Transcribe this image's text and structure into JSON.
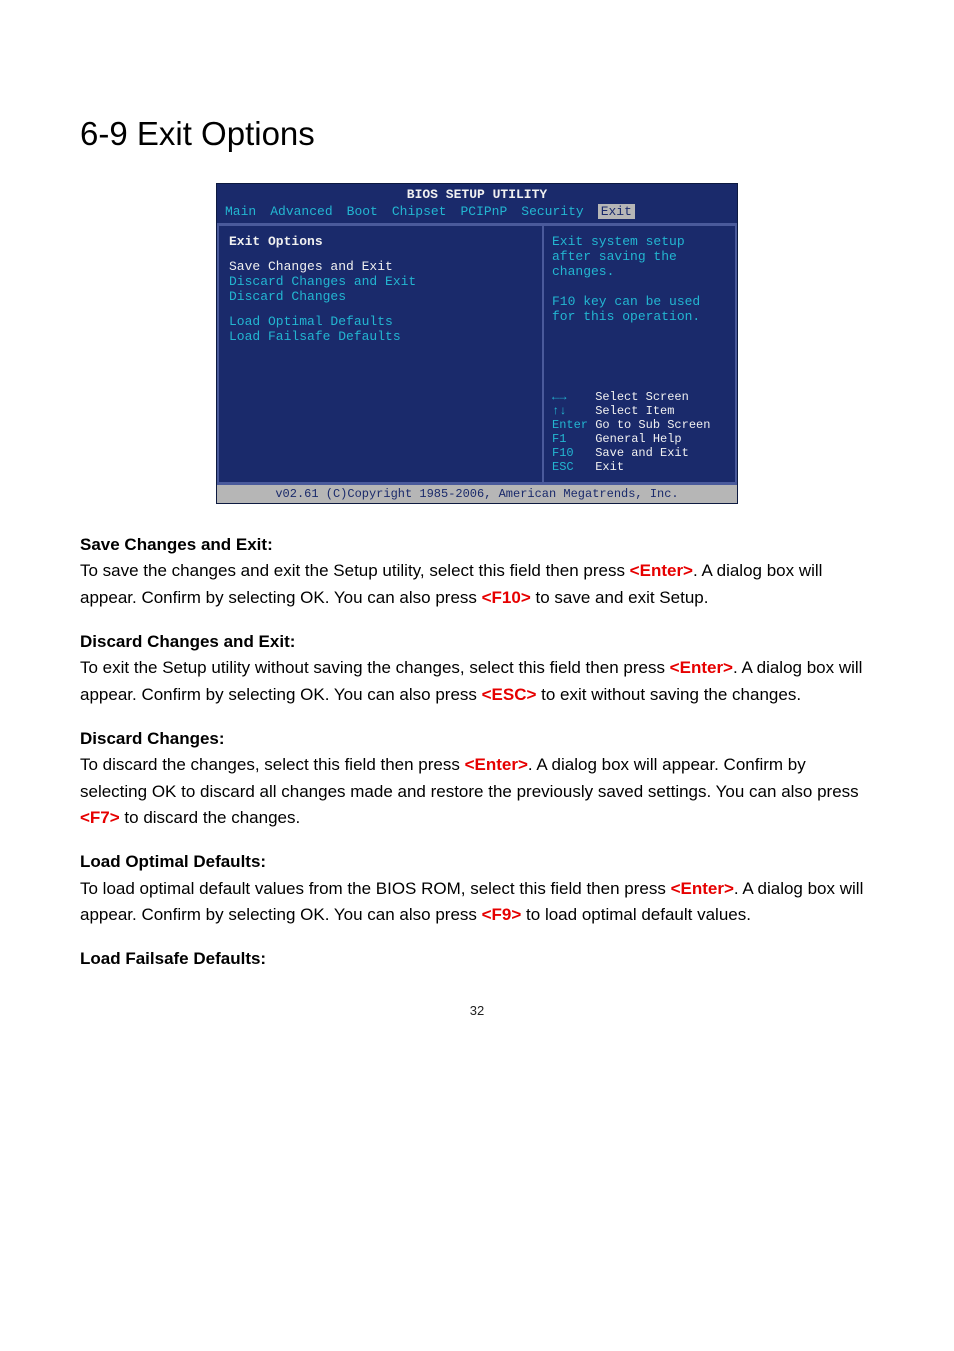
{
  "heading": "6-9 Exit Options",
  "bios": {
    "title": "BIOS SETUP UTILITY",
    "tabs": [
      "Main",
      "Advanced",
      "Boot",
      "Chipset",
      "PCIPnP",
      "Security",
      "Exit"
    ],
    "selected_tab": "Exit",
    "panel_header": "Exit Options",
    "items": [
      "Save Changes and Exit",
      "Discard Changes and Exit",
      "Discard Changes",
      "Load Optimal Defaults",
      "Load Failsafe Defaults"
    ],
    "help_top": "Exit system setup after saving the changes.\n\nF10 key can be used for this operation.",
    "keys": [
      {
        "k": "←→",
        "a": "Select Screen"
      },
      {
        "k": "↑↓",
        "a": "Select Item"
      },
      {
        "k": "Enter",
        "a": "Go to Sub Screen"
      },
      {
        "k": "F1",
        "a": "General Help"
      },
      {
        "k": "F10",
        "a": "Save and Exit"
      },
      {
        "k": "ESC",
        "a": "Exit"
      }
    ],
    "footer": "v02.61 (C)Copyright 1985-2006, American Megatrends, Inc."
  },
  "sections": {
    "s1": {
      "title": "Save Changes and Exit:",
      "t1": "To save the changes and exit the Setup utility, select this field then press ",
      "k1": "<Enter>",
      "t2": ". A dialog box will appear. Confirm by selecting OK. You can also press ",
      "k2": "<F10>",
      "t3": " to save and exit Setup."
    },
    "s2": {
      "title": "Discard Changes and Exit:",
      "t1": "To exit the Setup utility without saving the changes, select this field then press ",
      "k1": "<Enter>",
      "t2": ". A dialog box will appear. Confirm by selecting OK. You can also press ",
      "k2": "<ESC>",
      "t3": " to exit without saving the changes."
    },
    "s3": {
      "title": "Discard Changes:",
      "t1": "To discard the changes, select this field then press ",
      "k1": "<Enter>",
      "t2": ". A dialog box will appear. Confirm by selecting OK to discard all changes made and restore the previously saved settings. You can also press ",
      "k2": "<F7>",
      "t3": " to discard the changes."
    },
    "s4": {
      "title": "Load Optimal Defaults:",
      "t1": "To load optimal default values from the BIOS ROM, select this field then press ",
      "k1": "<Enter>",
      "t2": ". A dialog box will appear. Confirm by selecting OK. You can also press ",
      "k2": "<F9>",
      "t3": " to load optimal default values."
    },
    "s5": {
      "title": "Load Failsafe Defaults:"
    }
  },
  "pagenum": "32"
}
